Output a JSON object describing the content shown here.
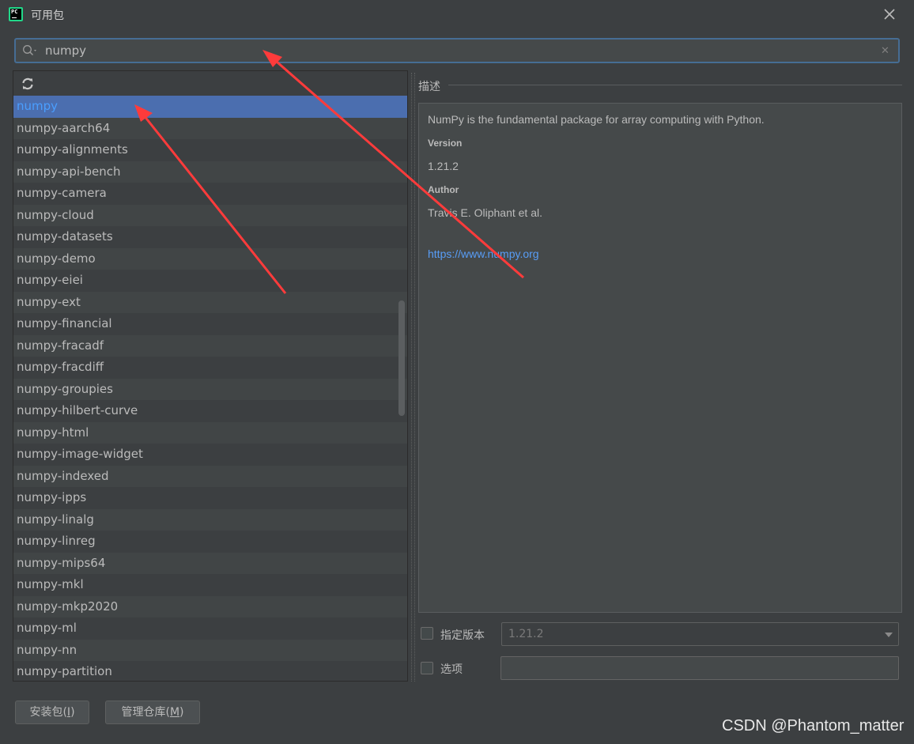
{
  "window": {
    "title": "可用包",
    "close_icon": "close-icon",
    "app_icon": "pycharm-icon",
    "app_icon_text": "PC"
  },
  "search": {
    "value": "numpy",
    "placeholder": ""
  },
  "packages": [
    "numpy",
    "numpy-aarch64",
    "numpy-alignments",
    "numpy-api-bench",
    "numpy-camera",
    "numpy-cloud",
    "numpy-datasets",
    "numpy-demo",
    "numpy-eiei",
    "numpy-ext",
    "numpy-financial",
    "numpy-fracadf",
    "numpy-fracdiff",
    "numpy-groupies",
    "numpy-hilbert-curve",
    "numpy-html",
    "numpy-image-widget",
    "numpy-indexed",
    "numpy-ipps",
    "numpy-linalg",
    "numpy-linreg",
    "numpy-mips64",
    "numpy-mkl",
    "numpy-mkp2020",
    "numpy-ml",
    "numpy-nn",
    "numpy-partition"
  ],
  "selected_package": "numpy",
  "description": {
    "label": "描述",
    "summary": "NumPy is the fundamental package for array computing with Python.",
    "version_label": "Version",
    "version": "1.21.2",
    "author_label": "Author",
    "author": "Travis E. Oliphant et al.",
    "url": "https://www.numpy.org"
  },
  "options": {
    "specify_version_label": "指定版本",
    "specify_version_checked": false,
    "version_value": "1.21.2",
    "options_label": "选项",
    "options_checked": false,
    "options_value": ""
  },
  "buttons": {
    "install_prefix": "安装包(",
    "install_key": "I",
    "install_suffix": ")",
    "manage_prefix": "管理仓库(",
    "manage_key": "M",
    "manage_suffix": ")"
  },
  "watermark": "CSDN @Phantom_matter",
  "colors": {
    "accent": "#4b6eaf",
    "link": "#589df6",
    "arrow": "#ff3b3b",
    "background": "#3c3f41"
  }
}
